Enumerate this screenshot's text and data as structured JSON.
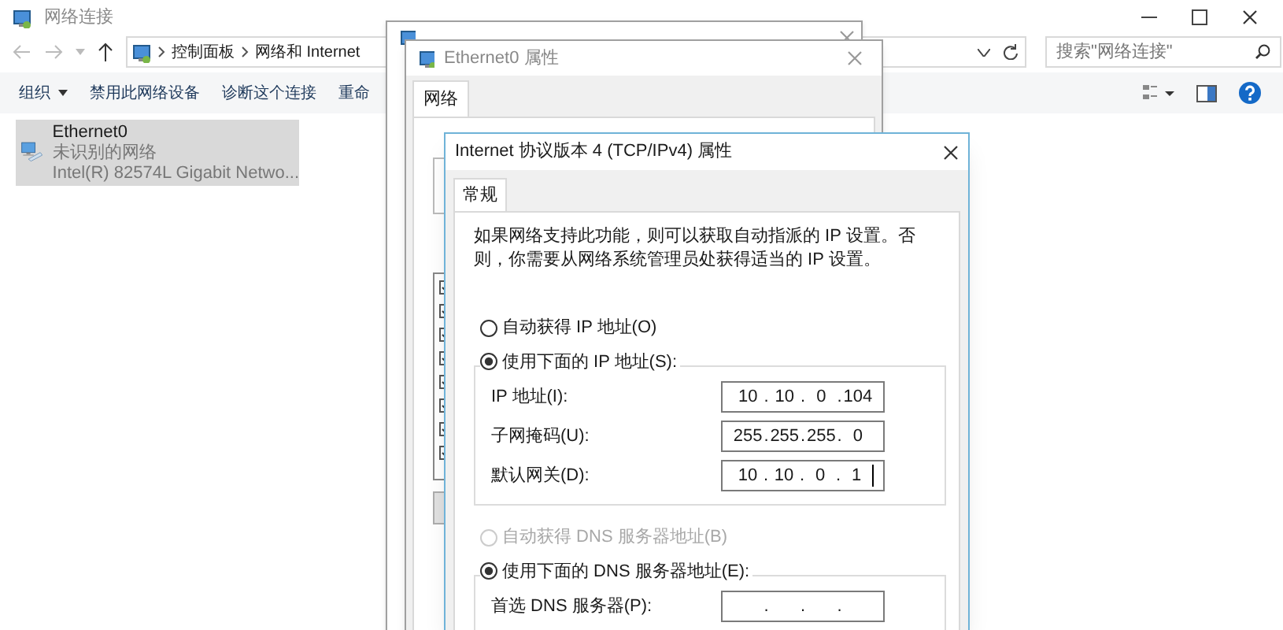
{
  "explorer": {
    "title": "网络连接",
    "breadcrumb": [
      "控制面板",
      "网络和 Internet"
    ],
    "search_placeholder": "搜索\"网络连接\"",
    "toolbar": [
      {
        "label": "组织",
        "menu": true
      },
      {
        "label": "禁用此网络设备",
        "menu": false
      },
      {
        "label": "诊断这个连接",
        "menu": false
      },
      {
        "label": "重命",
        "menu": false
      }
    ],
    "items": [
      {
        "name": "Ethernet0",
        "status": "未识别的网络",
        "device": "Intel(R) 82574L Gigabit Netwo...",
        "selected": true
      }
    ]
  },
  "properties_window": {
    "title": "Ethernet0 属性",
    "tabs": [
      {
        "label": "网络",
        "selected": true
      }
    ]
  },
  "ipv4_dialog": {
    "title": "Internet 协议版本 4 (TCP/IPv4) 属性",
    "tabs": [
      {
        "label": "常规",
        "selected": true
      }
    ],
    "description": "如果网络支持此功能，则可以获取自动指派的 IP 设置。否则，你需要从网络系统管理员处获得适当的 IP 设置。",
    "separator": ".",
    "groups": [
      {
        "auto": {
          "label": "自动获得 IP 地址(O)",
          "selected": false,
          "disabled": false
        },
        "manual": {
          "label": "使用下面的 IP 地址(S):",
          "selected": true
        },
        "fields": [
          {
            "label": "IP 地址(I):",
            "octets": [
              "10",
              "10",
              "0",
              "104"
            ],
            "focused": false
          },
          {
            "label": "子网掩码(U):",
            "octets": [
              "255",
              "255",
              "255",
              "0"
            ],
            "focused": false
          },
          {
            "label": "默认网关(D):",
            "octets": [
              "10",
              "10",
              "0",
              "1"
            ],
            "focused": true
          }
        ]
      },
      {
        "auto": {
          "label": "自动获得 DNS 服务器地址(B)",
          "selected": false,
          "disabled": true
        },
        "manual": {
          "label": "使用下面的 DNS 服务器地址(E):",
          "selected": true
        },
        "fields": [
          {
            "label": "首选 DNS 服务器(P):",
            "focused": false
          }
        ]
      }
    ]
  }
}
